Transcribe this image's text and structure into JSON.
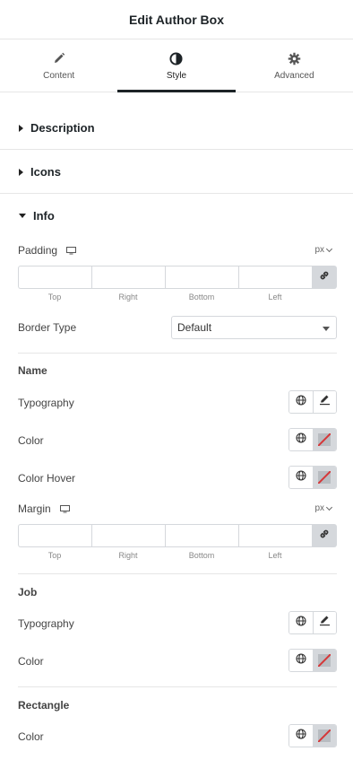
{
  "header": {
    "title": "Edit Author Box"
  },
  "tabs": [
    {
      "label": "Content",
      "icon": "pencil-icon"
    },
    {
      "label": "Style",
      "icon": "contrast-icon",
      "active": true
    },
    {
      "label": "Advanced",
      "icon": "gear-icon"
    }
  ],
  "sections": {
    "description": "Description",
    "icons": "Icons",
    "info": "Info"
  },
  "info": {
    "padding": {
      "label": "Padding",
      "unit": "px",
      "top": "",
      "right": "",
      "bottom": "",
      "left": ""
    },
    "dim_labels": [
      "Top",
      "Right",
      "Bottom",
      "Left"
    ],
    "border_type": {
      "label": "Border Type",
      "value": "Default"
    },
    "name": {
      "heading": "Name",
      "typography": "Typography",
      "color": "Color",
      "color_hover": "Color Hover",
      "margin": {
        "label": "Margin",
        "unit": "px",
        "top": "",
        "right": "",
        "bottom": "",
        "left": ""
      }
    },
    "job": {
      "heading": "Job",
      "typography": "Typography",
      "color": "Color"
    },
    "rectangle": {
      "heading": "Rectangle",
      "color": "Color"
    }
  },
  "colors": {
    "accent": "#1d2327",
    "unset_slash": "#d63638",
    "border": "#d5d8dc"
  }
}
